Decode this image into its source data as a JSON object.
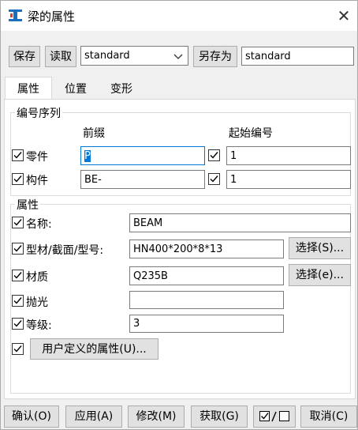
{
  "window": {
    "title": "梁的属性",
    "close_label": "✕"
  },
  "toolbar": {
    "save_label": "保存",
    "load_label": "读取",
    "preset_value": "standard",
    "save_as_label": "另存为",
    "save_as_value": "standard"
  },
  "tabs": [
    {
      "label": "属性",
      "active": true
    },
    {
      "label": "位置",
      "active": false
    },
    {
      "label": "变形",
      "active": false
    }
  ],
  "numbering": {
    "group_label": "编号序列",
    "prefix_header": "前缀",
    "start_header": "起始编号",
    "rows": [
      {
        "label": "零件",
        "checked": true,
        "prefix": "P",
        "start_checked": true,
        "start": "1"
      },
      {
        "label": "构件",
        "checked": true,
        "prefix": "BE-",
        "start_checked": true,
        "start": "1"
      }
    ]
  },
  "attributes": {
    "group_label": "属性",
    "name_label": "名称:",
    "name_value": "BEAM",
    "profile_label": "型材/截面/型号:",
    "profile_value": "HN400*200*8*13",
    "profile_select": "选择(S)...",
    "material_label": "材质",
    "material_value": "Q235B",
    "material_select": "选择(e)...",
    "finish_label": "抛光",
    "finish_value": "",
    "class_label": "等级:",
    "class_value": "3",
    "udp_label": "用户定义的属性(U)..."
  },
  "footer": {
    "ok": "确认(O)",
    "apply": "应用(A)",
    "modify": "修改(M)",
    "get": "获取(G)",
    "cancel": "取消(C)"
  },
  "colors": {
    "accent": "#0078d7",
    "window_bg": "#f0f0f0",
    "button_bg": "#e1e1e1"
  }
}
